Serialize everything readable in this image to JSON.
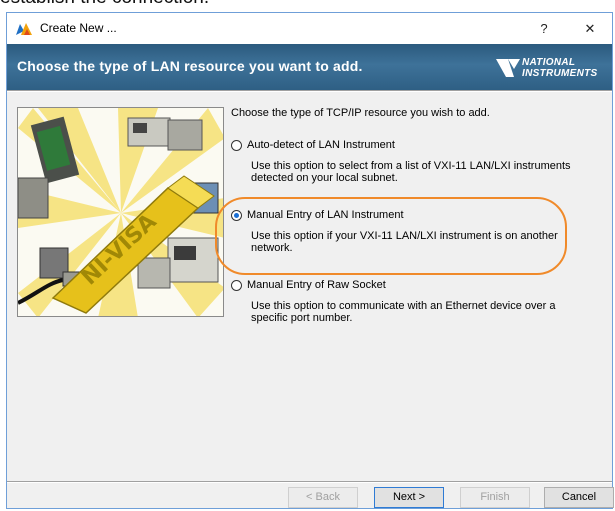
{
  "background": {
    "clipped_text": "establish the connection."
  },
  "window": {
    "title": "Create New ...",
    "help_glyph": "?",
    "close_glyph": "✕"
  },
  "banner": {
    "text": "Choose the type of LAN resource you want to add.",
    "logo_line1": "NATIONAL",
    "logo_line2": "INSTRUMENTS"
  },
  "graphic": {
    "label": "NI-VISA"
  },
  "main": {
    "heading": "Choose the type of TCP/IP resource you wish to add.",
    "options": [
      {
        "label": "Auto-detect of LAN Instrument",
        "description": "Use this option to select from a list of VXI-11 LAN/LXI instruments detected on your local subnet.",
        "selected": false
      },
      {
        "label": "Manual Entry of LAN Instrument",
        "description": "Use this option if your VXI-11 LAN/LXI instrument is on another network.",
        "selected": true
      },
      {
        "label": "Manual Entry of Raw Socket",
        "description": "Use this option to communicate with an Ethernet device over a specific port number.",
        "selected": false
      }
    ]
  },
  "buttons": {
    "back": "< Back",
    "next": "Next >",
    "finish": "Finish",
    "cancel": "Cancel"
  },
  "colors": {
    "banner": "#3e7299",
    "highlight": "#f08a2a",
    "radio_selected": "#1a6fd6"
  }
}
